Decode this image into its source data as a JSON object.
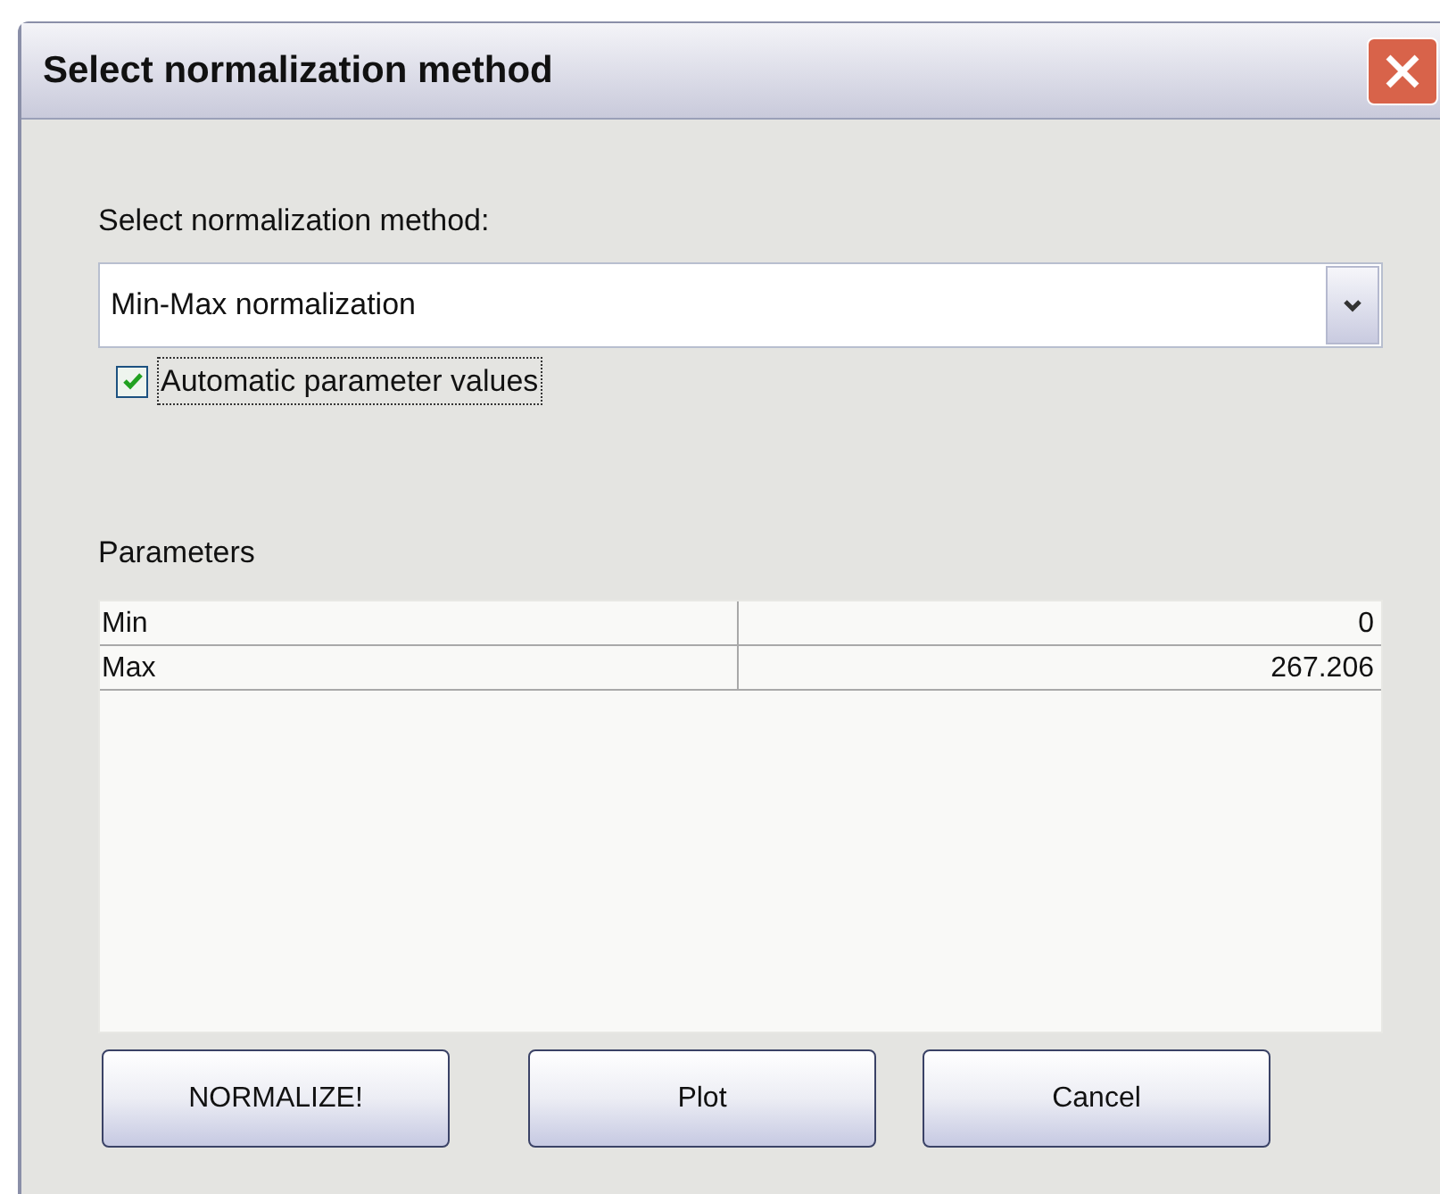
{
  "window": {
    "title": "Select normalization method"
  },
  "method_label": "Select normalization method:",
  "method_dropdown": {
    "value": "Min-Max normalization"
  },
  "auto_checkbox": {
    "label": "Automatic parameter values",
    "checked": true
  },
  "parameters": {
    "label": "Parameters",
    "rows": [
      {
        "name": "Min",
        "value": "0"
      },
      {
        "name": "Max",
        "value": "267.206"
      }
    ]
  },
  "buttons": [
    "NORMALIZE!",
    "Plot",
    "Cancel"
  ]
}
